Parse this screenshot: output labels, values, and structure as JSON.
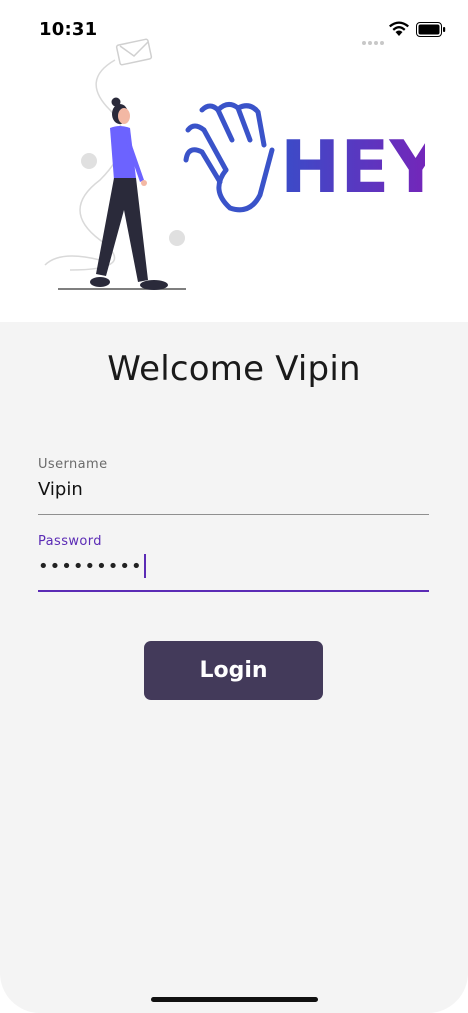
{
  "status_bar": {
    "time": "10:31"
  },
  "logo": {
    "text": "HEY"
  },
  "welcome": {
    "title": "Welcome Vipin"
  },
  "form": {
    "username": {
      "label": "Username",
      "value": "Vipin"
    },
    "password": {
      "label": "Password",
      "masked_value": "•••••••••"
    }
  },
  "login_button": {
    "label": "Login"
  },
  "colors": {
    "accent": "#5b2bb5",
    "button": "#433a5a",
    "background": "#f4f4f4"
  }
}
